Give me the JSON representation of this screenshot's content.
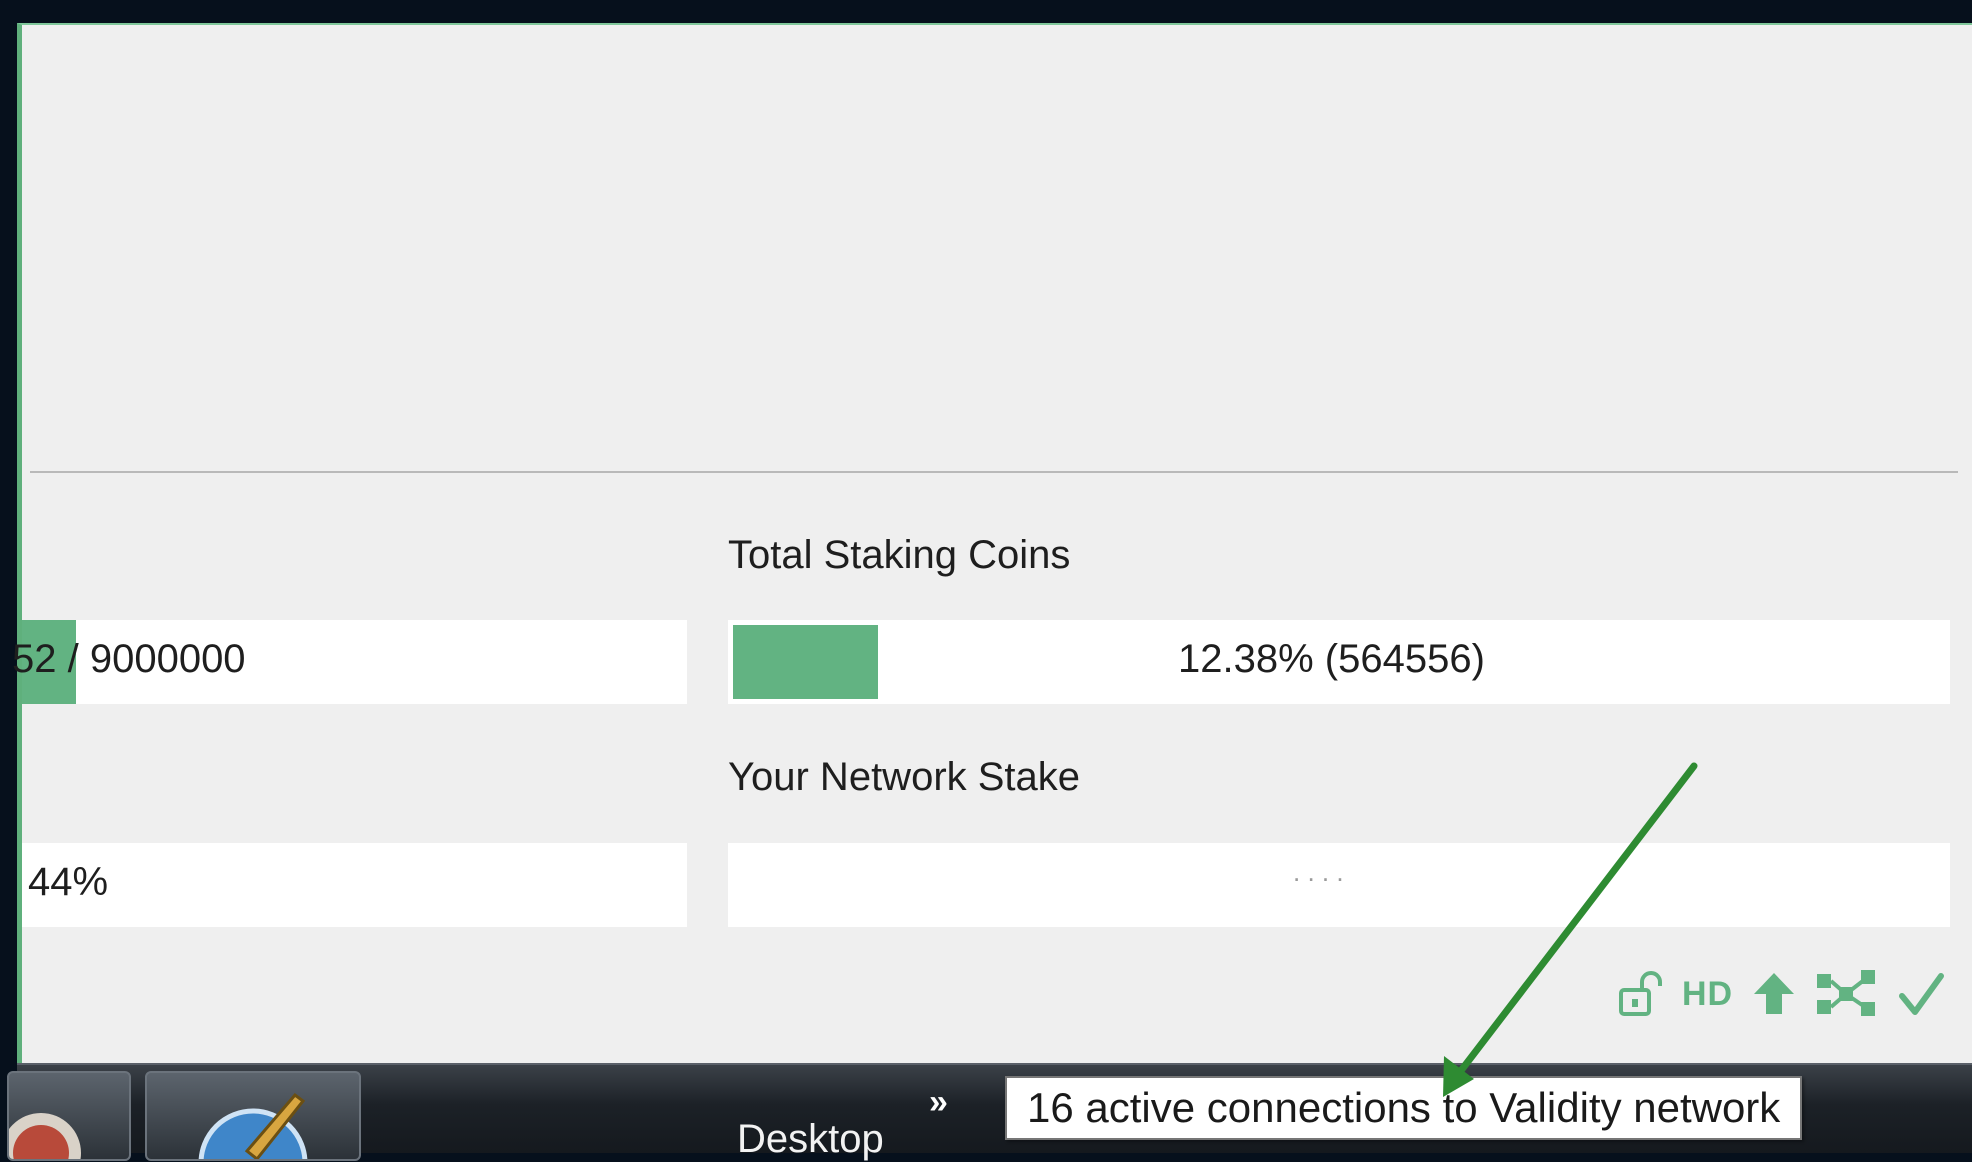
{
  "panel": {
    "total_staking_label": "Total Staking Coins",
    "network_stake_label": "Your Network Stake",
    "supply_value": "52 / 9000000",
    "supply_fill_fraction": 0.09,
    "staking_value": "12.38% (564556)",
    "staking_fill_fraction": 0.1238,
    "left_percent": "44%",
    "network_stake_value": ". . . ."
  },
  "status_bar": {
    "hd_label": "HD",
    "icons": [
      "unlock-icon",
      "hd-icon",
      "staking-arrow-icon",
      "network-icon",
      "synced-check-icon"
    ]
  },
  "taskbar": {
    "desktop_label": "Desktop",
    "chevron": "»"
  },
  "tooltip": {
    "text": "16 active connections to Validity network"
  },
  "colors": {
    "accent": "#62b382",
    "arrow": "#2e8b32",
    "window_bg": "#efefef"
  }
}
